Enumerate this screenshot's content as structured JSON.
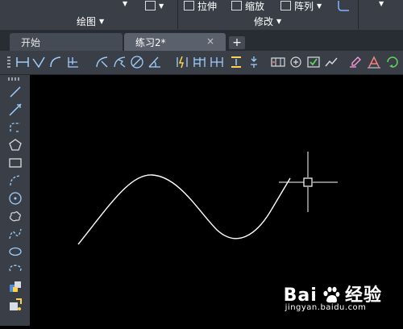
{
  "ribbon": {
    "stretch_label": "拉伸",
    "scale_label": "缩放",
    "array_label": "阵列",
    "draw_group_label": "绘图",
    "modify_group_label": "修改"
  },
  "tabs": [
    {
      "label": "开始"
    },
    {
      "label": "练习2*",
      "close": "×"
    }
  ],
  "new_tab": "+",
  "watermark": {
    "brand_left": "Bai",
    "brand_right": "经验",
    "url": "jingyan.baidu.com"
  }
}
